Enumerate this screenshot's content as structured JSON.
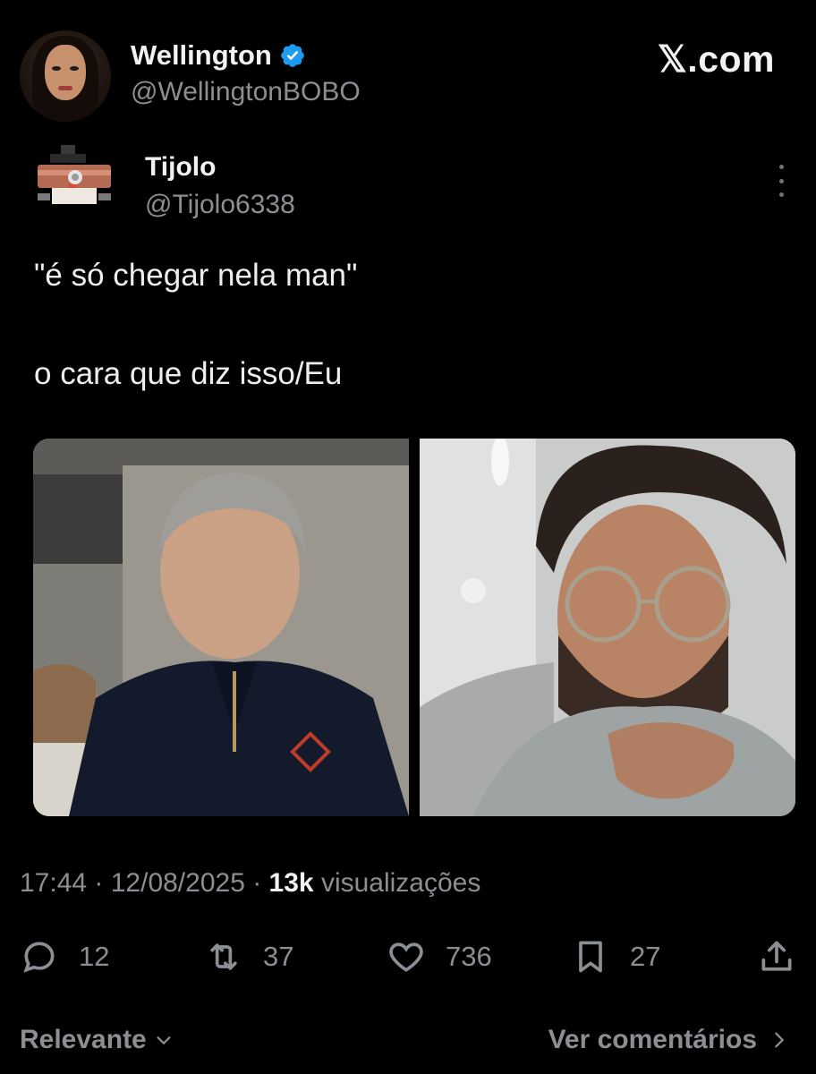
{
  "header": {
    "display_name": "Wellington",
    "handle": "@WellingtonBOBO",
    "site_logo": "𝕏.com"
  },
  "quoted": {
    "display_name": "Tijolo",
    "handle": "@Tijolo6338",
    "text_line1": "\"é só chegar nela man\"",
    "text_line2": "o cara que diz isso/Eu"
  },
  "meta": {
    "time_date": "17:44 · 12/08/2025 · ",
    "views_count": "13k",
    "views_label": " visualizações"
  },
  "actions": {
    "replies": "12",
    "reposts": "37",
    "likes": "736",
    "bookmarks": "27"
  },
  "footer": {
    "sort_label": "Relevante",
    "comments_link": "Ver comentários"
  },
  "colors": {
    "background": "#000000",
    "text_primary": "#e7e9ea",
    "text_secondary": "#8b8f94",
    "verified": "#1d9bf0"
  }
}
